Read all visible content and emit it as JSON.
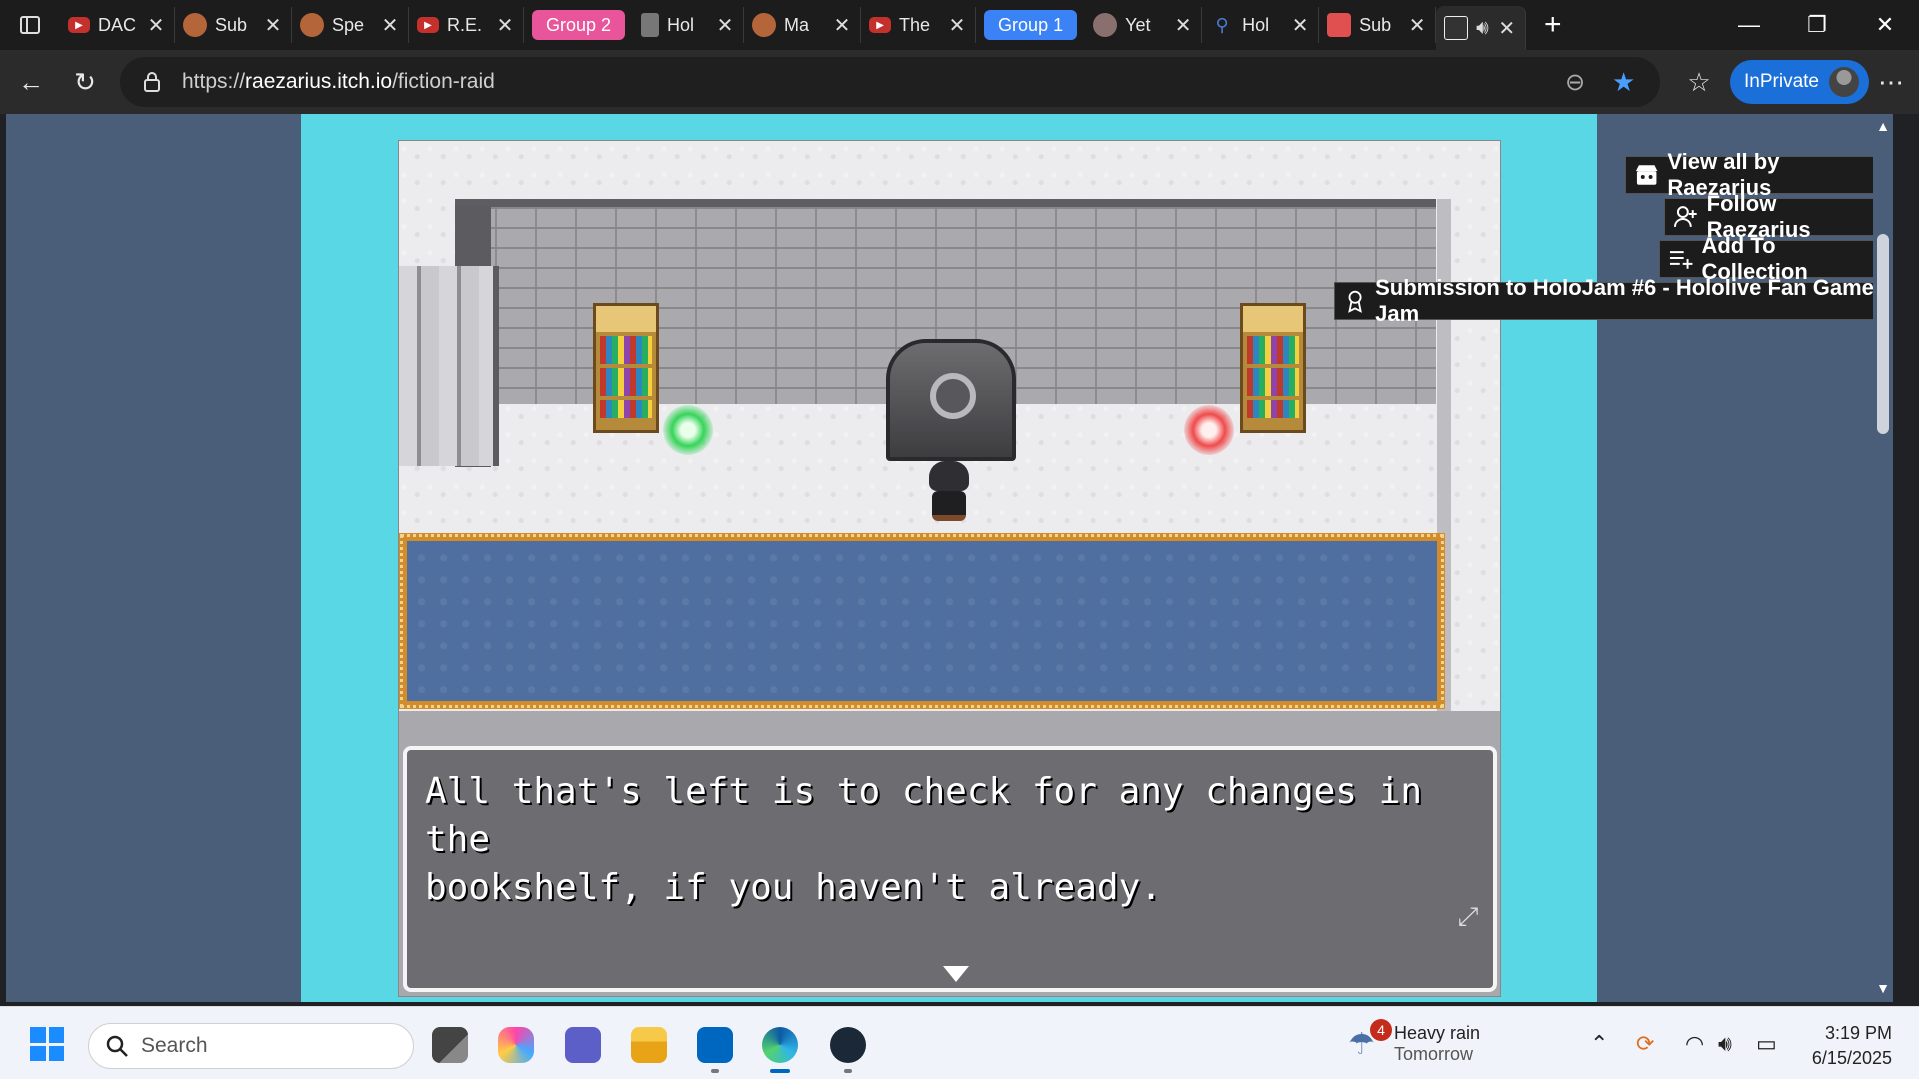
{
  "browser": {
    "tabs": [
      {
        "title": "DAC",
        "favicon": "youtube-icon",
        "color": "#c4302b"
      },
      {
        "title": "Sub",
        "favicon": "character-avatar-icon",
        "color": "#b5653a"
      },
      {
        "title": "Spe",
        "favicon": "character-avatar-icon",
        "color": "#b5653a"
      },
      {
        "title": "R.E.",
        "favicon": "youtube-icon",
        "color": "#c4302b"
      },
      {
        "title": "Hol",
        "favicon": "book-icon",
        "color": "#777777"
      },
      {
        "title": "Ma",
        "favicon": "character-avatar-icon",
        "color": "#b5653a"
      },
      {
        "title": "The",
        "favicon": "youtube-icon",
        "color": "#c4302b"
      },
      {
        "title": "Yet",
        "favicon": "character-avatar-icon",
        "color": "#8a6f6f"
      },
      {
        "title": "Hol",
        "favicon": "search-icon",
        "color": "#4a7bd0"
      },
      {
        "title": "Sub",
        "favicon": "itch-icon",
        "color": "#e05050"
      },
      {
        "title": "",
        "favicon": "game-icon",
        "color": "#333333"
      }
    ],
    "groups": [
      {
        "label": "Group 2",
        "color": "#e8559a"
      },
      {
        "label": "Group 1",
        "color": "#3b82f6"
      }
    ],
    "url": {
      "prefix": "https://",
      "host": "raezarius.itch.io",
      "path": "/fiction-raid"
    },
    "inprivate_label": "InPrivate"
  },
  "itch": {
    "view_all": "View all by Raezarius",
    "follow": "Follow Raezarius",
    "add_collection": "Add To Collection",
    "submission": "Submission to HoloJam #6 - Hololive Fan Game Jam"
  },
  "game": {
    "dialog_line1": "All that's left is to check for any changes in the",
    "dialog_line2": "bookshelf, if you haven't already."
  },
  "taskbar": {
    "search_placeholder": "Search",
    "weather_badge": "4",
    "weather_condition": "Heavy rain",
    "weather_when": "Tomorrow",
    "time": "3:19 PM",
    "date": "6/15/2025"
  }
}
